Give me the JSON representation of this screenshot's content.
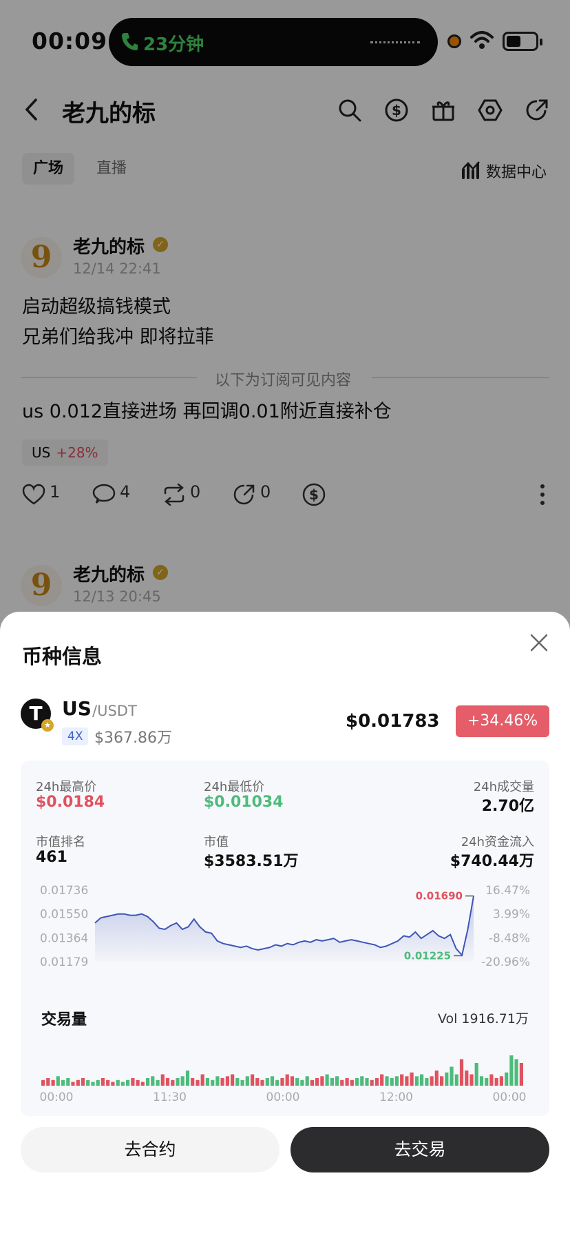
{
  "status_bar": {
    "time": "00:09",
    "call_duration": "23分钟"
  },
  "header": {
    "title": "老九的标",
    "icons": [
      "back-icon",
      "search-icon",
      "dollar-icon",
      "gift-icon",
      "settings-icon",
      "share-icon"
    ]
  },
  "tabs": {
    "plaza": "广场",
    "live": "直播",
    "data_center": "数据中心"
  },
  "posts": [
    {
      "author": "老九的标",
      "avatar_text": "9",
      "time": "12/14 22:41",
      "lines": [
        "启动超级搞钱模式",
        "兄弟们给我冲 即将拉菲"
      ],
      "subscription_divider": "以下为订阅可见内容",
      "hidden_text": "us 0.012直接进场 再回调0.01附近直接补仓",
      "tag_symbol": "US",
      "tag_change": "+28%",
      "likes": "1",
      "comments": "4",
      "reposts": "0",
      "shares": "0"
    },
    {
      "author": "老九的标",
      "avatar_text": "9",
      "time": "12/13 20:45"
    }
  ],
  "coin_sheet": {
    "title": "币种信息",
    "symbol": "US",
    "pair": "/USDT",
    "logo_text": "T",
    "leverage": "4X",
    "market_cap_short": "$367.86万",
    "price": "$0.01783",
    "change": "+34.46%",
    "stats": {
      "high_label": "24h最高价",
      "high": "$0.0184",
      "low_label": "24h最低价",
      "low": "$0.01034",
      "volume_label": "24h成交量",
      "volume": "2.70亿",
      "rank_label": "市值排名",
      "rank": "461",
      "mcap_label": "市值",
      "mcap": "$3583.51万",
      "inflow_label": "24h资金流入",
      "inflow": "$740.44万"
    },
    "volume_title": "交易量",
    "volume_total": "Vol 1916.71万",
    "buttons": {
      "contract": "去合约",
      "trade": "去交易"
    },
    "colors": {
      "up": "#e0525f",
      "down": "#4dbb7b",
      "line": "#3d55b8"
    }
  },
  "chart_data": [
    {
      "type": "line",
      "title": "",
      "y_ticks_left": [
        "0.01736",
        "0.01550",
        "0.01364",
        "0.01179"
      ],
      "y_ticks_right": [
        "16.47%",
        "3.99%",
        "-8.48%",
        "-20.96%"
      ],
      "ylim": [
        0.01179,
        0.01736
      ],
      "high_label": "0.01690",
      "low_label": "0.01225",
      "series": [
        {
          "values": [
            0.0148,
            0.0152,
            0.0153,
            0.0154,
            0.0155,
            0.0155,
            0.0154,
            0.0154,
            0.0155,
            0.0153,
            0.0149,
            0.0144,
            0.0143,
            0.0146,
            0.0148,
            0.0143,
            0.0145,
            0.0151,
            0.0145,
            0.0141,
            0.014,
            0.0134,
            0.0132,
            0.0131,
            0.013,
            0.0129,
            0.013,
            0.0128,
            0.0127,
            0.0128,
            0.0129,
            0.0131,
            0.013,
            0.0132,
            0.0131,
            0.0133,
            0.0134,
            0.0133,
            0.0135,
            0.0134,
            0.0135,
            0.0136,
            0.0133,
            0.0134,
            0.0135,
            0.0134,
            0.0133,
            0.0132,
            0.0131,
            0.0129,
            0.013,
            0.0132,
            0.0134,
            0.0138,
            0.0137,
            0.0141,
            0.0136,
            0.0139,
            0.0142,
            0.0138,
            0.0136,
            0.0139,
            0.0128,
            0.0123,
            0.0143,
            0.0169
          ]
        }
      ]
    },
    {
      "type": "bar",
      "title": "交易量",
      "x_ticks": [
        "00:00",
        "11:30",
        "00:00",
        "12:00",
        "00:00"
      ],
      "values": [
        3,
        4,
        3,
        5,
        3,
        4,
        2,
        3,
        4,
        3,
        2,
        3,
        4,
        3,
        2,
        3,
        2,
        3,
        4,
        3,
        2,
        4,
        5,
        3,
        6,
        4,
        3,
        4,
        5,
        8,
        4,
        3,
        6,
        4,
        3,
        5,
        4,
        5,
        6,
        4,
        3,
        5,
        6,
        4,
        3,
        4,
        5,
        3,
        4,
        6,
        5,
        4,
        3,
        5,
        3,
        4,
        5,
        6,
        4,
        5,
        3,
        4,
        3,
        4,
        5,
        4,
        3,
        4,
        6,
        5,
        4,
        5,
        6,
        5,
        7,
        5,
        6,
        4,
        5,
        8,
        5,
        7,
        10,
        6,
        14,
        8,
        6,
        12,
        5,
        4,
        6,
        4,
        5,
        7,
        16,
        14,
        12
      ],
      "colors": [
        "up",
        "down"
      ]
    }
  ]
}
